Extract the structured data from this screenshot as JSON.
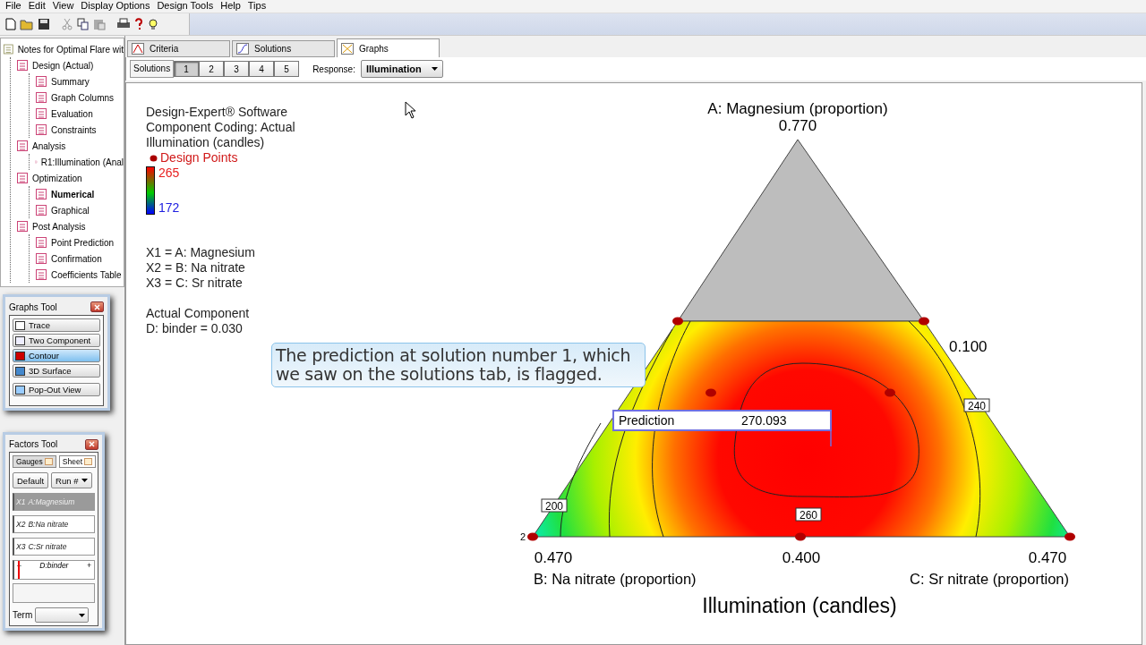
{
  "menu": [
    "File",
    "Edit",
    "View",
    "Display Options",
    "Design Tools",
    "Help",
    "Tips"
  ],
  "tree": {
    "label": "Notes for Optimal Flare wit",
    "children": [
      {
        "label": "Design (Actual)",
        "selected": false,
        "children": [
          {
            "label": "Summary",
            "selected": false
          },
          {
            "label": "Graph Columns",
            "selected": false
          },
          {
            "label": "Evaluation",
            "selected": false
          },
          {
            "label": "Constraints",
            "selected": false
          }
        ]
      },
      {
        "label": "Analysis",
        "selected": false,
        "children": [
          {
            "label": "R1:Illumination (Anal",
            "selected": false
          }
        ]
      },
      {
        "label": "Optimization",
        "selected": false,
        "children": [
          {
            "label": "Numerical",
            "selected": true
          },
          {
            "label": "Graphical",
            "selected": false
          }
        ]
      },
      {
        "label": "Post Analysis",
        "selected": false,
        "children": [
          {
            "label": "Point Prediction",
            "selected": false
          },
          {
            "label": "Confirmation",
            "selected": false
          },
          {
            "label": "Coefficients Table",
            "selected": false
          }
        ]
      }
    ]
  },
  "graphs_tool": {
    "title": "Graphs Tool",
    "buttons": [
      {
        "label": "Trace",
        "selected": false
      },
      {
        "label": "Two Component",
        "selected": false
      },
      {
        "label": "Contour",
        "selected": true
      },
      {
        "label": "3D Surface",
        "selected": false
      },
      {
        "label": "Pop-Out View",
        "selected": false
      }
    ]
  },
  "factors_tool": {
    "title": "Factors Tool",
    "tabs": [
      {
        "label": "Gauges",
        "selected": true
      },
      {
        "label": "Sheet",
        "selected": false
      }
    ],
    "default_button": "Default",
    "run_select": "Run #",
    "factors": [
      {
        "code": "X1",
        "label": "A:Magnesium",
        "selected": true
      },
      {
        "code": "X2",
        "label": "B:Na nitrate",
        "selected": false
      },
      {
        "code": "X3",
        "label": "C:Sr nitrate",
        "selected": false
      }
    ],
    "slider": {
      "label": "D:binder",
      "minus": "–",
      "plus": "+",
      "level": 0.05
    },
    "term_label": "Term"
  },
  "tabs": [
    {
      "label": "Criteria",
      "selected": false
    },
    {
      "label": "Solutions",
      "selected": false
    },
    {
      "label": "Graphs",
      "selected": true
    }
  ],
  "solutions_bar": {
    "label": "Solutions",
    "buttons": [
      {
        "label": "1",
        "selected": true
      },
      {
        "label": "2",
        "selected": false
      },
      {
        "label": "3",
        "selected": false
      },
      {
        "label": "4",
        "selected": false
      },
      {
        "label": "5",
        "selected": false
      }
    ],
    "response_label": "Response:",
    "response_value": "Illumination"
  },
  "legend": {
    "header_lines": [
      "Design-Expert® Software",
      "Component Coding: Actual",
      "Illumination (candles)"
    ],
    "design_points": "Design Points",
    "scale_high": "265",
    "scale_low": "172",
    "factor_lines": [
      "X1 = A: Magnesium",
      "X2 = B: Na nitrate",
      "X3 = C: Sr nitrate"
    ],
    "actual_lines": [
      "Actual Component",
      "D: binder = 0.030"
    ]
  },
  "plot": {
    "top_axis": "A: Magnesium (proportion)",
    "top_value": "0.770",
    "right_value": "0.100",
    "bottom_left_value": "0.470",
    "bottom_center_value": "0.400",
    "bottom_right_value": "0.470",
    "left_axis": "B: Na nitrate (proportion)",
    "right_axis": "C: Sr nitrate (proportion)",
    "title": "Illumination (candles)",
    "replicates": "2",
    "contour_labels": [
      {
        "label": "240",
        "kind": "right"
      },
      {
        "label": "260",
        "kind": "bottom"
      },
      {
        "label": "200",
        "kind": "left"
      }
    ],
    "prediction": {
      "label": "Prediction",
      "value": "270.093"
    }
  },
  "callout": "The prediction at solution number 1, which we saw on the solutions tab, is flagged."
}
